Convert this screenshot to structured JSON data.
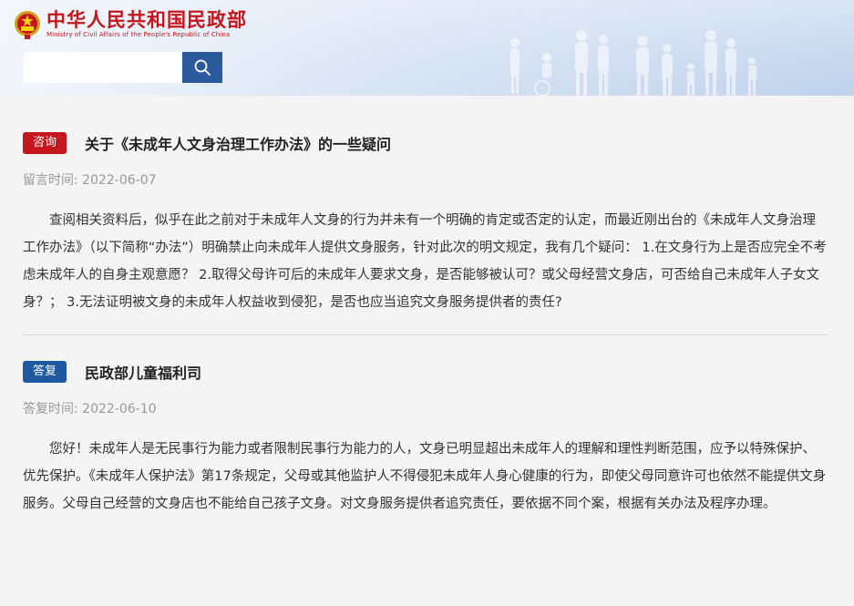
{
  "header": {
    "logo_cn": "中华人民共和国民政部",
    "logo_en": "Ministry of Civil Affairs of the People's Republic of China",
    "search_placeholder": ""
  },
  "question": {
    "tag": "咨询",
    "title": "关于《未成年人文身治理工作办法》的一些疑问",
    "time_label": "留言时间:",
    "time_value": "2022-06-07",
    "body": "查阅相关资料后，似乎在此之前对于未成年人文身的行为并未有一个明确的肯定或否定的认定，而最近刚出台的《未成年人文身治理工作办法》（以下简称“办法”）明确禁止向未成年人提供文身服务，针对此次的明文规定，我有几个疑问： 1.在文身行为上是否应完全不考虑未成年人的自身主观意愿？ 2.取得父母许可后的未成年人要求文身，是否能够被认可？或父母经营文身店，可否给自己未成年人子女文身？； 3.无法证明被文身的未成年人权益收到侵犯，是否也应当追究文身服务提供者的责任?"
  },
  "answer": {
    "tag": "答复",
    "title": "民政部儿童福利司",
    "time_label": "答复时间:",
    "time_value": "2022-06-10",
    "body": "您好！未成年人是无民事行为能力或者限制民事行为能力的人，文身已明显超出未成年人的理解和理性判断范围，应予以特殊保护、优先保护。《未成年人保护法》第17条规定，父母或其他监护人不得侵犯未成年人身心健康的行为，即使父母同意许可也依然不能提供文身服务。父母自己经营的文身店也不能给自己孩子文身。对文身服务提供者追究责任，要依据不同个案，根据有关办法及程序办理。"
  },
  "colors": {
    "brand_red": "#c4161c",
    "brand_blue": "#1f5aa0",
    "search_blue": "#2a5a9b"
  },
  "icons": {
    "search": "search-icon",
    "emblem": "national-emblem-icon"
  }
}
